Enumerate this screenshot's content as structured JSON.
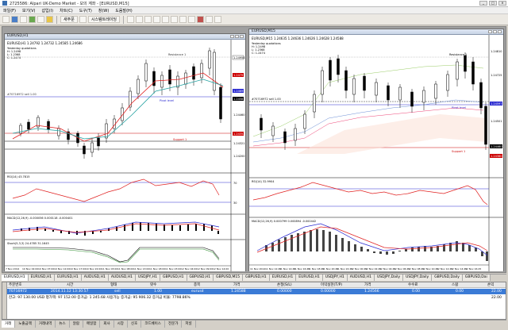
{
  "window": {
    "title": "2725586: Alpari UK-Demo Market - 모의 계좌 - [EURUSD,M15]",
    "buttons": [
      "_",
      "□",
      "×"
    ]
  },
  "menu": [
    "파일(F)",
    "보기(V)",
    "삽입(I)",
    "차트(C)",
    "도구(T)",
    "창(W)",
    "도움말(H)"
  ],
  "toolbar": {
    "new_order": "새주문",
    "auto_trading": "시스템트레이딩"
  },
  "chart_left": {
    "caption": "EURUSD,H1",
    "header": "EURUSD,H1  1.24792 1.24732 1.24585 1.24686",
    "yesterday": [
      "Yesterday quotations",
      "H: 1.2498",
      "L: 1.2368",
      "C: 1.2474"
    ],
    "resistance": "Resistance 1",
    "pivot": "Pivot level",
    "support": "Support 1",
    "order_line": "#70716972 sell 1.00",
    "rsi_label": "RSI(14) 43.7815",
    "macd_label": "MACD(12,26,9) -0.000056 0.000118 -0.000401",
    "stoch_label": "Stoch(5,3,3) 24.4785 31.1645",
    "prices": [
      "1.24958",
      "1.24791",
      "1.24695",
      "1.24583",
      "1.24460",
      "1.24352",
      "1.24321",
      "1.24200"
    ],
    "rsi_levels": [
      "70",
      "30"
    ],
    "time_labels": [
      "7 Nov 2014",
      "10 Nov 02:00",
      "10 Nov 07:00",
      "10 Nov 12:00",
      "10 Nov 17:00",
      "10 Nov 22:00",
      "11 Nov 03:00",
      "11 Nov 08:00",
      "11 Nov 13:00",
      "11 Nov 18:00",
      "11 Nov 23:00",
      "12 Nov 04:00",
      "12 Nov 09:00",
      "12 Nov 14:00"
    ]
  },
  "chart_right": {
    "caption": "EURUSD,M15",
    "header": "EURUSD,M15  1.24635 1.24636 1.24626 1.24628 1.24588",
    "yesterday": [
      "Yesterday quotations",
      "H: 1.2498",
      "L: 1.2368",
      "C: 1.2474"
    ],
    "resistance": "Resistance 1",
    "pivot": "Pivot level",
    "support": "Support 1",
    "order_line": "#70716972 sell 1.00",
    "rsi_label": "RSI(14) 32.9904",
    "macd_label": "MACD(12,26,9) 0.000799 0.000894 -0.000442",
    "prices": [
      "1.24810",
      "1.24725",
      "1.24597",
      "1.24501",
      "1.24460",
      "1.24380"
    ],
    "time_labels": [
      "11 Nov 2014",
      "11 Nov 12:45",
      "11 Nov 14:45",
      "11 Nov 16:45",
      "11 Nov 18:45",
      "11 Nov 20:45",
      "11 Nov 22:45",
      "12 Nov 00:45",
      "12 Nov 02:45",
      "12 Nov 04:45",
      "12 Nov 06:45",
      "12 Nov 08:45",
      "12 Nov 10:45",
      "12 Nov 12:45",
      "12 Nov 14:45",
      "12 Nov 16:45"
    ]
  },
  "symbol_tabs": [
    "EURUSD,H1",
    "EURUSD,H1",
    "EURUSD,H1",
    "AUDUSD,H1",
    "AUDUSD,H1",
    "USDJPY,H1",
    "GBPUSD,H1",
    "GBPUSD,H1",
    "GBPUSD,M15",
    "GBPUSD,H1",
    "EURUSD,H1",
    "EURUSD,H1",
    "USDJPY,H1",
    "AUDUSD,H1",
    "USDJPY,Daily",
    "USDJPY,Daily",
    "GBPUSD,Daily",
    "GBPUSD,Dai"
  ],
  "active_symbol_tab": 0,
  "terminal": {
    "headers": [
      "주문번호",
      "시간",
      "형태",
      "랏수",
      "종목",
      "가격",
      "손절(S/L)",
      "이익실현(T/P)",
      "가격",
      "수수료",
      "스왑",
      "손익"
    ],
    "row": {
      "order": "70716972",
      "time": "2014.11.12 13:30:57",
      "type": "sell",
      "lots": "1.00",
      "symbol": "eurusd",
      "price": "1.24588",
      "sl": "0.00000",
      "tp": "0.00000",
      "cur_price": "1.24566",
      "commission": "0.00",
      "swap": "0.00",
      "profit": "22.00"
    },
    "balance_line": "잔고: 97 130.00 USD  평가액: 97 152.00  증거금: 1 245.68  사용가능 증거금: 95 906.32  증거금 비율: 7798.86%",
    "balance_total": "22.00"
  },
  "terminal_tabs": [
    "거래",
    "노출금액",
    "거래내역",
    "뉴스",
    "알람",
    "메일함",
    "회사",
    "시장",
    "신호",
    "코드베이스",
    "전문가",
    "저널"
  ],
  "active_terminal_tab": 0
}
